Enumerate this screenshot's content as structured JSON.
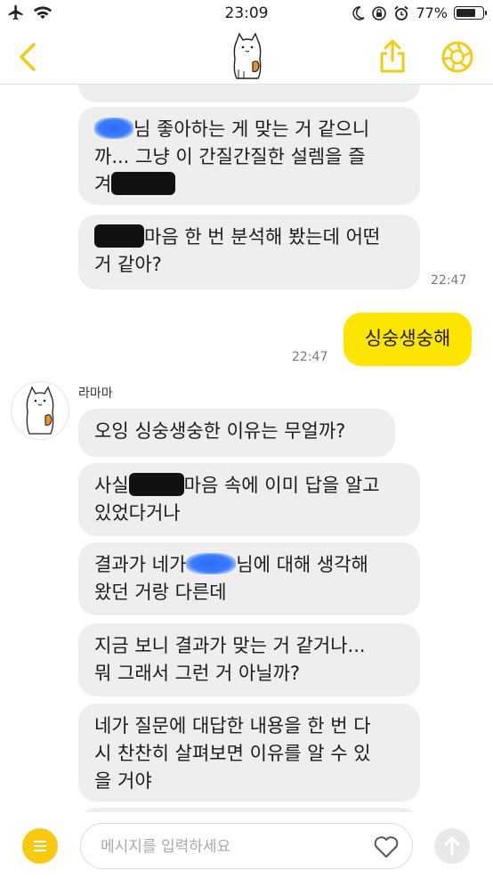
{
  "status_bar": {
    "time": "23:09",
    "battery": "77%",
    "battery_level": 0.77
  },
  "nav": {
    "avatar_icon": "cat-icon",
    "accent": "#f7c90f"
  },
  "messages": {
    "m1": {
      "line1": "님 좋아하는 게 맞는 거 같으니",
      "line2": "까... 그냥 이 간질간질한 설렘을 즐",
      "line3": "겨"
    },
    "m2": {
      "line1": "마음 한 번 분석해 봤는데 어떤",
      "line2": "거 같아?",
      "time": "22:47"
    },
    "m3": {
      "text": "싱숭생숭해",
      "time": "22:47"
    },
    "sender": "라마마",
    "m4": {
      "text": "오잉 싱숭생숭한 이유는 무얼까?"
    },
    "m5": {
      "line1_a": "사실",
      "line1_b": "마음 속에 이미 답을 알고",
      "line2": "있었다거나"
    },
    "m6": {
      "line1_a": "결과가 네가",
      "line1_b": "님에 대해 생각해",
      "line2": "왔던 거랑 다른데"
    },
    "m7": {
      "line1": "지금 보니 결과가 맞는 거 같거나...",
      "line2": "뭐 그래서 그런 거 아닐까?"
    },
    "m8": {
      "line1": "네가 질문에 대답한 내용을 한 번 다",
      "line2": "시 찬찬히 살펴보면 이유를 알 수 있",
      "line3": "을 거야"
    }
  },
  "composer": {
    "placeholder": "메시지를 입력하세요"
  }
}
